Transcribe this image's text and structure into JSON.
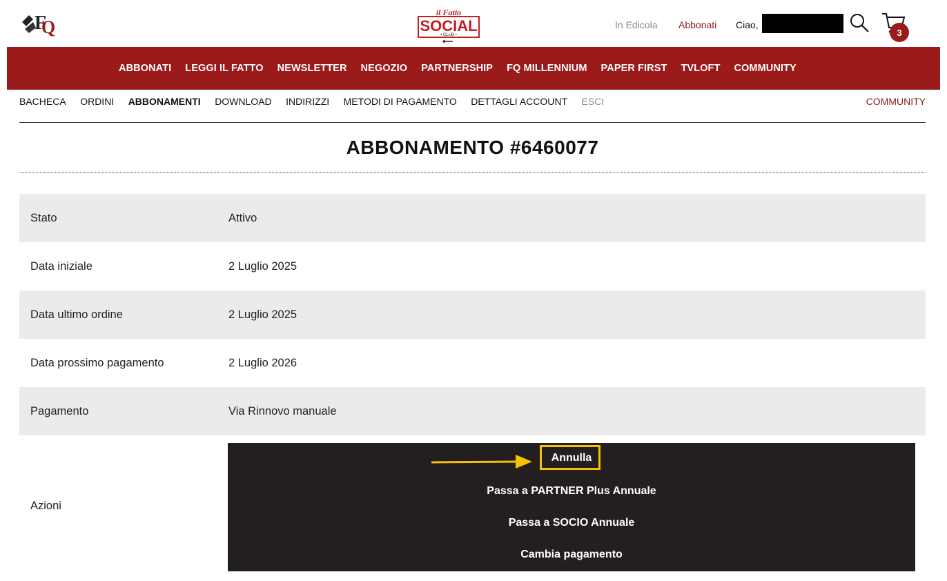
{
  "header": {
    "in_edicola": "In Edicola",
    "abbonati": "Abbonati",
    "greeting": "Ciao,",
    "cart_count": "3",
    "logos": {
      "left": "fq-logo",
      "center": "il-fatto-social-club-logo"
    },
    "logo_text": {
      "il_fatto": "il Fatto",
      "social": "SOCIAL",
      "club": "• CLUB •"
    }
  },
  "main_nav": [
    "ABBONATI",
    "LEGGI IL FATTO",
    "NEWSLETTER",
    "NEGOZIO",
    "PARTNERSHIP",
    "FQ MILLENNIUM",
    "PAPER FIRST",
    "TVLOFT",
    "COMMUNITY"
  ],
  "account_nav": {
    "items": [
      "BACHECA",
      "ORDINI",
      "ABBONAMENTI",
      "DOWNLOAD",
      "INDIRIZZI",
      "METODI DI PAGAMENTO",
      "DETTAGLI ACCOUNT",
      "ESCI"
    ],
    "community": "COMMUNITY"
  },
  "page": {
    "title": "ABBONAMENTO #6460077"
  },
  "details": [
    {
      "label": "Stato",
      "value": "Attivo"
    },
    {
      "label": "Data iniziale",
      "value": "2 Luglio 2025"
    },
    {
      "label": "Data ultimo ordine",
      "value": "2 Luglio 2025"
    },
    {
      "label": "Data prossimo pagamento",
      "value": "2 Luglio 2026"
    },
    {
      "label": "Pagamento",
      "value": "Via Rinnovo manuale"
    }
  ],
  "actions": {
    "label": "Azioni",
    "buttons": [
      "Annulla",
      "Passa a PARTNER Plus Annuale",
      "Passa a SOCIO Annuale",
      "Cambia pagamento"
    ]
  },
  "colors": {
    "brand_red": "#9b1a1a",
    "highlight": "#f5c400",
    "actions_bg": "#231f20",
    "row_shade": "#ebebeb"
  }
}
